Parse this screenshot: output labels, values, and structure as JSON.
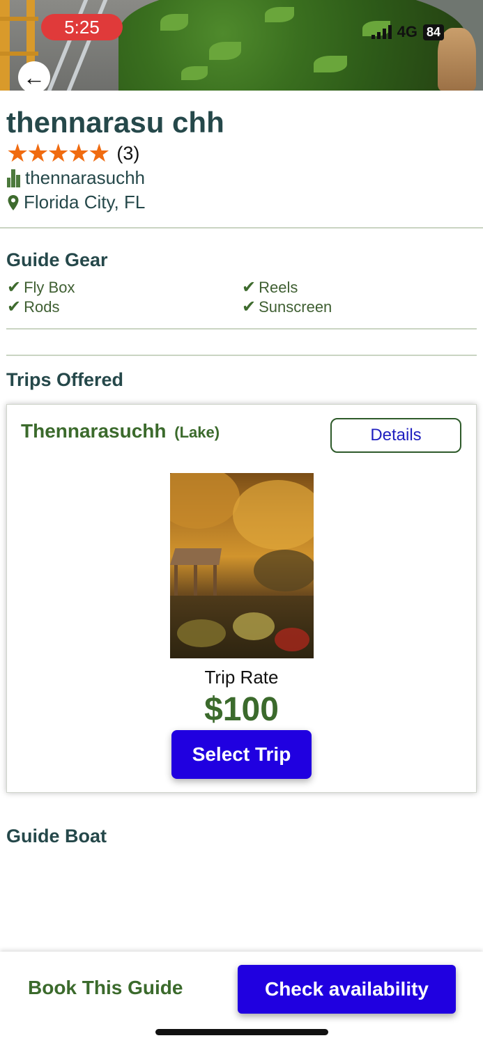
{
  "status_bar": {
    "time": "5:25",
    "network": "4G",
    "battery": "84"
  },
  "profile": {
    "name": "thennarasu chh",
    "stars": "★★★★★",
    "rating_count": "(3)",
    "username": "thennarasuchh",
    "location": "Florida City, FL"
  },
  "guide_gear": {
    "title": "Guide Gear",
    "items": [
      "Fly Box",
      "Reels",
      "Rods",
      "Sunscreen"
    ]
  },
  "trips": {
    "title": "Trips Offered",
    "items": [
      {
        "name": "Thennarasuchh",
        "type": "(Lake)",
        "details_label": "Details",
        "rate_label": "Trip Rate",
        "price": "$100",
        "select_label": "Select Trip"
      }
    ]
  },
  "guide_boat": {
    "title": "Guide Boat"
  },
  "footer": {
    "book_label": "Book This Guide",
    "check_label": "Check availability"
  },
  "colors": {
    "accent_blue": "#2000e0",
    "brand_green": "#3b6a2c",
    "heading": "#25484a",
    "star": "#f06b10"
  }
}
